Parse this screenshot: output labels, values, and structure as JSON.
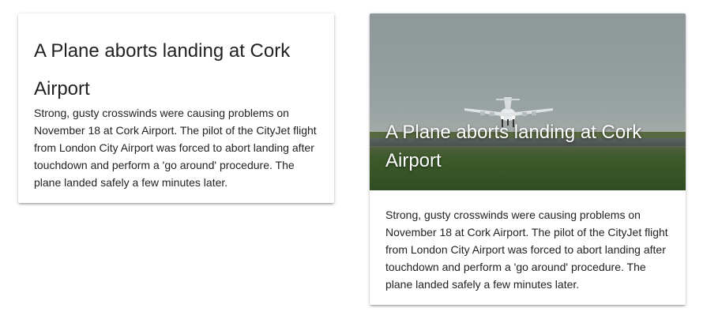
{
  "cards": [
    {
      "title": "A Plane aborts landing at Cork Airport",
      "body": "Strong, gusty crosswinds were causing problems on November 18 at Cork Airport. The pilot of the CityJet flight from London City Airport was forced to abort landing after touchdown and perform a 'go around' procedure. The plane landed safely a few minutes later."
    },
    {
      "title": "A Plane aborts landing at Cork Airport",
      "body": "Strong, gusty crosswinds were causing problems on November 18 at Cork Airport. The pilot of the CityJet flight from London City Airport was forced to abort landing after touchdown and perform a 'go around' procedure. The plane landed safely a few minutes later."
    }
  ]
}
